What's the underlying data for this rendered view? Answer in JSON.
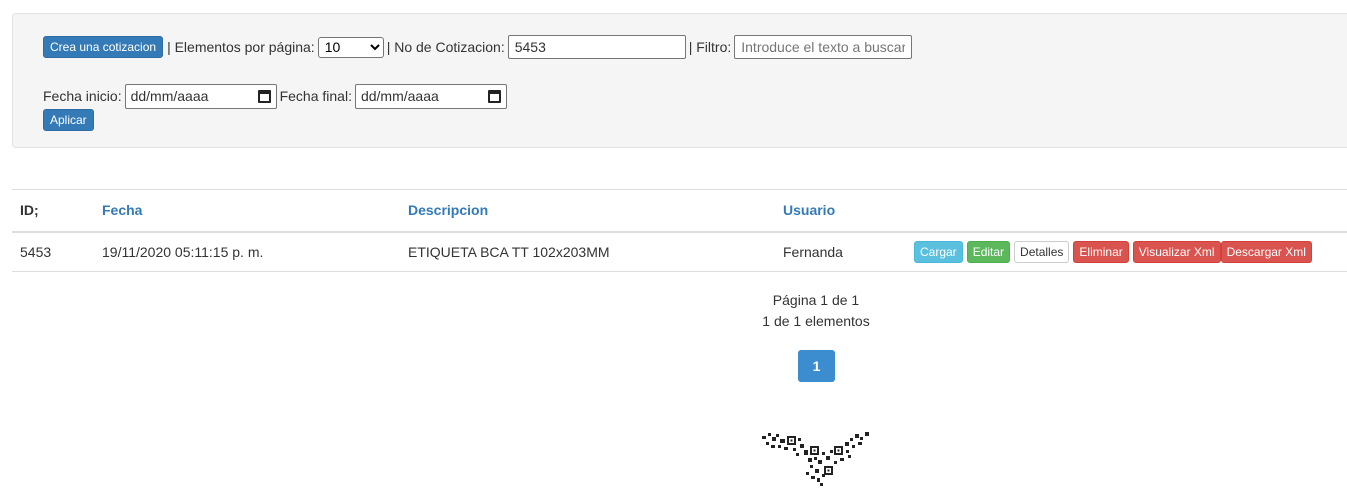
{
  "filters": {
    "create_button": "Crea una cotizacion",
    "sep1": "| Elementos por página:",
    "page_size_value": "10",
    "sep2": "| No de Cotizacion:",
    "quote_number_value": "5453",
    "sep3": "| Filtro:",
    "filter_placeholder": "Introduce el texto a buscar",
    "start_date_label": "Fecha inicio:",
    "start_date_value": "dd/mm/aaaa",
    "end_date_label": "Fecha final:",
    "end_date_value": "dd/mm/aaaa",
    "apply_button": "Aplicar"
  },
  "table": {
    "headers": [
      "ID;",
      "Fecha",
      "Descripcion",
      "Usuario"
    ],
    "rows": [
      {
        "id": "5453",
        "fecha": "19/11/2020 05:11:15 p. m.",
        "descripcion": "ETIQUETA BCA TT 102x203MM",
        "usuario": "Fernanda"
      }
    ],
    "actions": [
      "Cargar",
      "Editar",
      "Detalles",
      "Eliminar",
      "Visualizar Xml",
      "Descargar Xml"
    ]
  },
  "pagination": {
    "page_info": "Página 1 de 1",
    "items_info": "1 de 1 elementos",
    "current_page": "1"
  },
  "colors": {
    "primary": "#337ab7",
    "info": "#5bc0de",
    "success": "#5cb85c",
    "danger": "#d9534f",
    "page_active": "#3c8dcf"
  },
  "icons": [
    "calendar-icon",
    "chevron-down-icon",
    "qr-logo"
  ]
}
